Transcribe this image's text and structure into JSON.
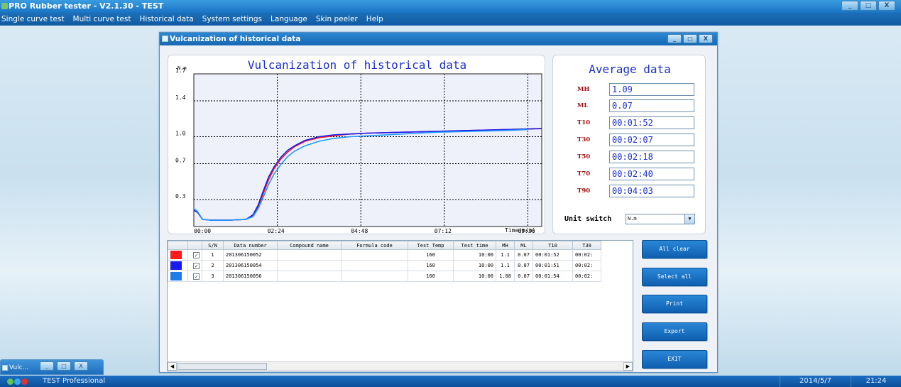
{
  "app": {
    "title": "PRO Rubber tester - V2.1.30 - TEST",
    "window_buttons": [
      "_",
      "□",
      "X"
    ]
  },
  "menu": {
    "items": [
      "Single curve test",
      "Multi curve test",
      "Historical data",
      "System settings",
      "Language",
      "Skin peeler",
      "Help"
    ]
  },
  "child_window": {
    "title": "Vulcanization of historical data",
    "buttons": [
      "_",
      "□",
      "X"
    ]
  },
  "chart": {
    "unit_label": "N.m",
    "x_axis_label": "Time(min)"
  },
  "chart_data": {
    "type": "line",
    "title": "Vulcanization of historical data",
    "ylabel": "N.m",
    "xlabel": "Time(min)",
    "x_ticks": [
      "00:00",
      "02:24",
      "04:48",
      "07:12",
      "09:36"
    ],
    "y_ticks": [
      "0.3",
      "0.7",
      "1.0",
      "1.4",
      "1.7"
    ],
    "xlim": [
      0,
      10
    ],
    "ylim": [
      0,
      1.7
    ],
    "grid": true,
    "series": [
      {
        "color": "#ff1a1a",
        "x": [
          0,
          0.1,
          0.25,
          0.5,
          1.0,
          1.5,
          1.7,
          1.85,
          2.0,
          2.15,
          2.3,
          2.5,
          2.7,
          2.9,
          3.2,
          3.6,
          4.0,
          4.5,
          5.0,
          6.0,
          7.0,
          8.0,
          9.0,
          10.0
        ],
        "y": [
          0.18,
          0.16,
          0.08,
          0.07,
          0.07,
          0.08,
          0.12,
          0.22,
          0.37,
          0.52,
          0.64,
          0.75,
          0.83,
          0.89,
          0.95,
          0.99,
          1.01,
          1.03,
          1.04,
          1.05,
          1.06,
          1.07,
          1.08,
          1.09
        ]
      },
      {
        "color": "#1a1aee",
        "x": [
          0,
          0.1,
          0.25,
          0.5,
          1.0,
          1.5,
          1.7,
          1.85,
          2.0,
          2.15,
          2.3,
          2.5,
          2.7,
          2.9,
          3.2,
          3.6,
          4.0,
          4.5,
          5.0,
          6.0,
          7.0,
          8.0,
          9.0,
          10.0
        ],
        "y": [
          0.18,
          0.16,
          0.08,
          0.07,
          0.07,
          0.08,
          0.13,
          0.24,
          0.4,
          0.55,
          0.66,
          0.77,
          0.85,
          0.9,
          0.96,
          1.0,
          1.02,
          1.03,
          1.04,
          1.05,
          1.06,
          1.07,
          1.08,
          1.09
        ]
      },
      {
        "color": "#1f9bff",
        "x": [
          0,
          0.1,
          0.25,
          0.5,
          1.0,
          1.5,
          1.7,
          1.85,
          2.0,
          2.15,
          2.3,
          2.5,
          2.7,
          2.9,
          3.2,
          3.6,
          4.0,
          4.5,
          5.0,
          6.0,
          7.0,
          8.0,
          9.0,
          9.6
        ],
        "y": [
          0.2,
          0.17,
          0.08,
          0.07,
          0.07,
          0.08,
          0.11,
          0.2,
          0.33,
          0.47,
          0.58,
          0.69,
          0.78,
          0.84,
          0.9,
          0.95,
          0.98,
          1.0,
          1.01,
          1.03,
          1.05,
          1.06,
          1.07,
          1.08
        ]
      }
    ]
  },
  "average": {
    "title": "Average data",
    "rows": [
      {
        "label": "MH",
        "value": "1.09"
      },
      {
        "label": "ML",
        "value": "0.07"
      },
      {
        "label": "T10",
        "value": "00:01:52"
      },
      {
        "label": "T30",
        "value": "00:02:07"
      },
      {
        "label": "T50",
        "value": "00:02:18"
      },
      {
        "label": "T70",
        "value": "00:02:40"
      },
      {
        "label": "T90",
        "value": "00:04:03"
      }
    ],
    "unit_switch_label": "Unit switch",
    "unit_value": "N.m"
  },
  "table": {
    "columns": [
      "S/N",
      "Data number",
      "Compound name",
      "Formula code",
      "Test Temp",
      "Test time",
      "MH",
      "ML",
      "T10",
      "T30"
    ],
    "rows": [
      {
        "color": "#ff1a1a",
        "checked": "✓",
        "sn": "1",
        "data_number": "201306150052",
        "compound": "",
        "formula": "",
        "temp": "160",
        "time": "10:00",
        "mh": "1.1",
        "ml": "0.07",
        "t10": "00:01:52",
        "t30": "00:02:"
      },
      {
        "color": "#1a1aee",
        "checked": "✓",
        "sn": "2",
        "data_number": "201306150054",
        "compound": "",
        "formula": "",
        "temp": "160",
        "time": "10:00",
        "mh": "1.1",
        "ml": "0.07",
        "t10": "00:01:51",
        "t30": "00:02:"
      },
      {
        "color": "#1f7be8",
        "checked": "✓",
        "sn": "3",
        "data_number": "201306150056",
        "compound": "",
        "formula": "",
        "temp": "160",
        "time": "10:00",
        "mh": "1.08",
        "ml": "0.07",
        "t10": "00:01:54",
        "t30": "00:02:"
      }
    ]
  },
  "side_buttons": {
    "all_clear": "All clear",
    "select_all": "Select all",
    "print": "Print",
    "export": "Export",
    "exit": "EXIT"
  },
  "minimized": {
    "title": "Vulc..."
  },
  "status": {
    "text": "TEST  Professional",
    "date": "2014/5/7",
    "time": "21:24"
  }
}
